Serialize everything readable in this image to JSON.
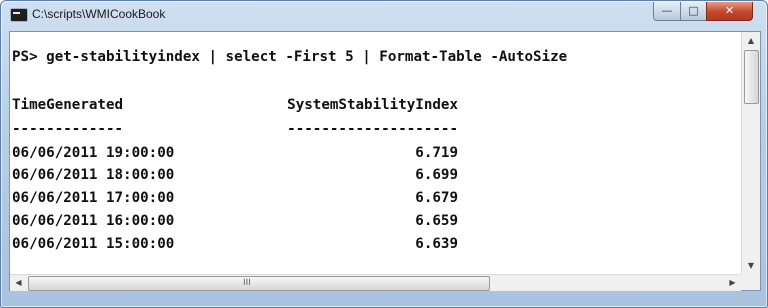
{
  "window": {
    "title": "C:\\scripts\\WMICookBook",
    "controls": {
      "minimize": "—",
      "maximize": "□",
      "close": "✕"
    }
  },
  "console": {
    "command": "PS> get-stabilityindex | select -First 5 | Format-Table -AutoSize",
    "headers": {
      "time": "TimeGenerated",
      "index": "SystemStabilityIndex"
    },
    "separators": {
      "time": "-------------",
      "index": "--------------------"
    },
    "rows": [
      {
        "time": "06/06/2011 19:00:00",
        "index": "6.719"
      },
      {
        "time": "06/06/2011 18:00:00",
        "index": "6.699"
      },
      {
        "time": "06/06/2011 17:00:00",
        "index": "6.679"
      },
      {
        "time": "06/06/2011 16:00:00",
        "index": "6.659"
      },
      {
        "time": "06/06/2011 15:00:00",
        "index": "6.639"
      }
    ]
  },
  "scrollbars": {
    "up": "▲",
    "down": "▼",
    "left": "◀",
    "right": "▶",
    "grip": "III"
  }
}
